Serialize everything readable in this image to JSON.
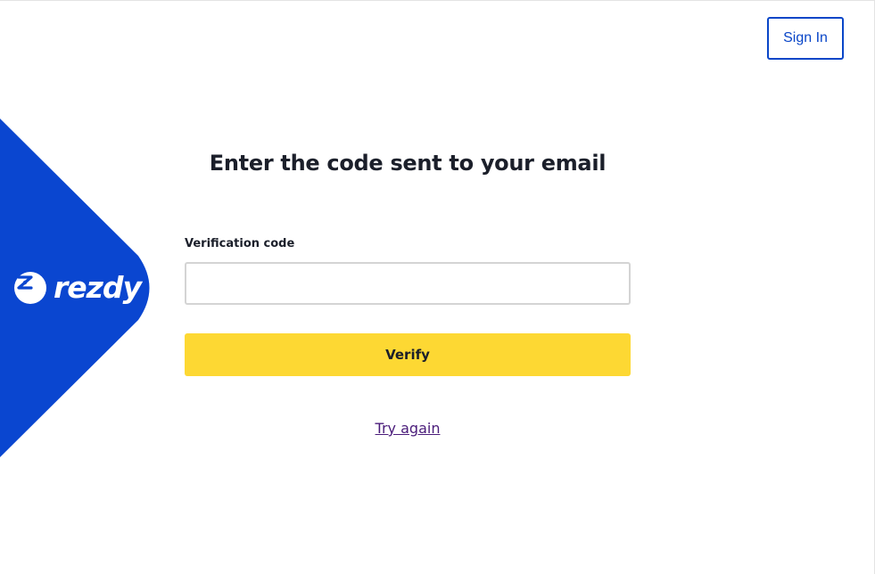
{
  "brand": {
    "name": "rezdy",
    "logo_icon": "rezdy-logo-icon",
    "panel_color": "#0a46d0"
  },
  "header": {
    "signin_label": "Sign In"
  },
  "form": {
    "heading": "Enter the code sent to your email",
    "code_label": "Verification code",
    "code_value": "",
    "verify_label": "Verify",
    "try_again_label": "Try again"
  },
  "colors": {
    "accent": "#0a46c8",
    "verify_button": "#fdd833",
    "link": "#4a1c7a"
  }
}
